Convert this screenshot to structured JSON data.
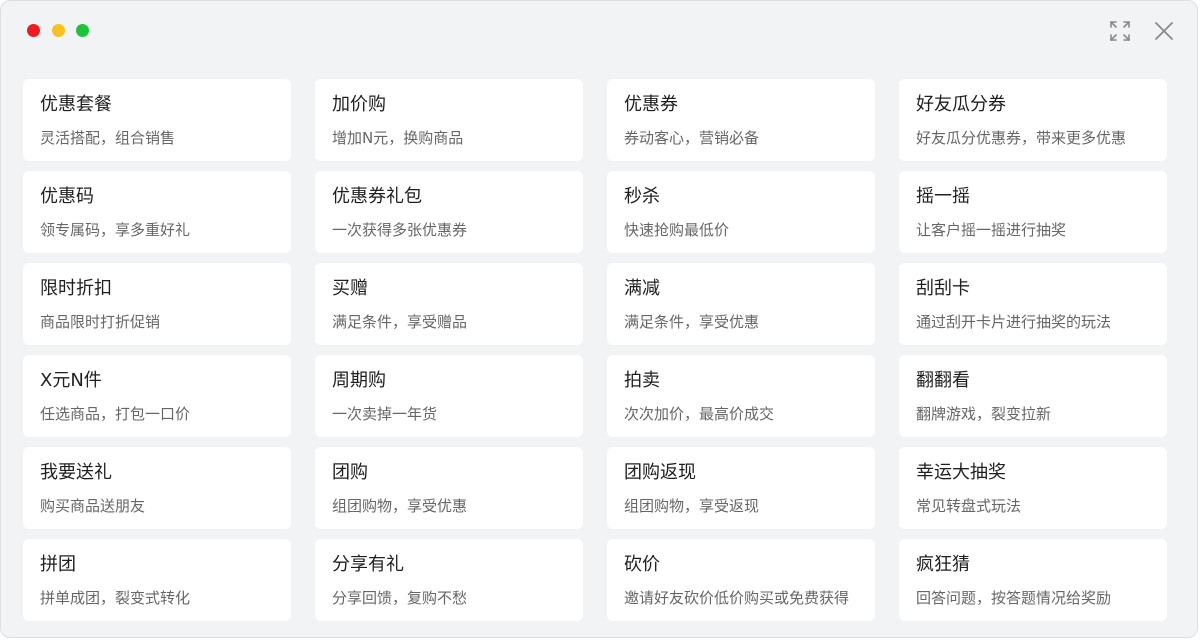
{
  "window": {
    "controls": {
      "close_dot": "#ee1c1c",
      "minimize_dot": "#f6c21b",
      "zoom_dot": "#1fc33a",
      "expand_icon": "expand-arrows-icon",
      "close_icon": "close-x-icon"
    }
  },
  "cards": [
    {
      "title": "优惠套餐",
      "desc": "灵活搭配，组合销售"
    },
    {
      "title": "加价购",
      "desc": "增加N元，换购商品"
    },
    {
      "title": "优惠券",
      "desc": "券动客心，营销必备"
    },
    {
      "title": "好友瓜分券",
      "desc": "好友瓜分优惠券，带来更多优惠"
    },
    {
      "title": "优惠码",
      "desc": "领专属码，享多重好礼"
    },
    {
      "title": "优惠券礼包",
      "desc": "一次获得多张优惠券"
    },
    {
      "title": "秒杀",
      "desc": "快速抢购最低价"
    },
    {
      "title": "摇一摇",
      "desc": "让客户摇一摇进行抽奖"
    },
    {
      "title": "限时折扣",
      "desc": "商品限时打折促销"
    },
    {
      "title": "买赠",
      "desc": "满足条件，享受赠品"
    },
    {
      "title": "满减",
      "desc": "满足条件，享受优惠"
    },
    {
      "title": "刮刮卡",
      "desc": "通过刮开卡片进行抽奖的玩法"
    },
    {
      "title": "X元N件",
      "desc": "任选商品，打包一口价"
    },
    {
      "title": "周期购",
      "desc": "一次卖掉一年货"
    },
    {
      "title": "拍卖",
      "desc": "次次加价，最高价成交"
    },
    {
      "title": "翻翻看",
      "desc": "翻牌游戏，裂变拉新"
    },
    {
      "title": "我要送礼",
      "desc": "购买商品送朋友"
    },
    {
      "title": "团购",
      "desc": "组团购物，享受优惠"
    },
    {
      "title": "团购返现",
      "desc": "组团购物，享受返现"
    },
    {
      "title": "幸运大抽奖",
      "desc": "常见转盘式玩法"
    },
    {
      "title": "拼团",
      "desc": "拼单成团，裂变式转化"
    },
    {
      "title": "分享有礼",
      "desc": "分享回馈，复购不愁"
    },
    {
      "title": "砍价",
      "desc": "邀请好友砍价低价购买或免费获得"
    },
    {
      "title": "疯狂猜",
      "desc": "回答问题，按答题情况给奖励"
    }
  ]
}
